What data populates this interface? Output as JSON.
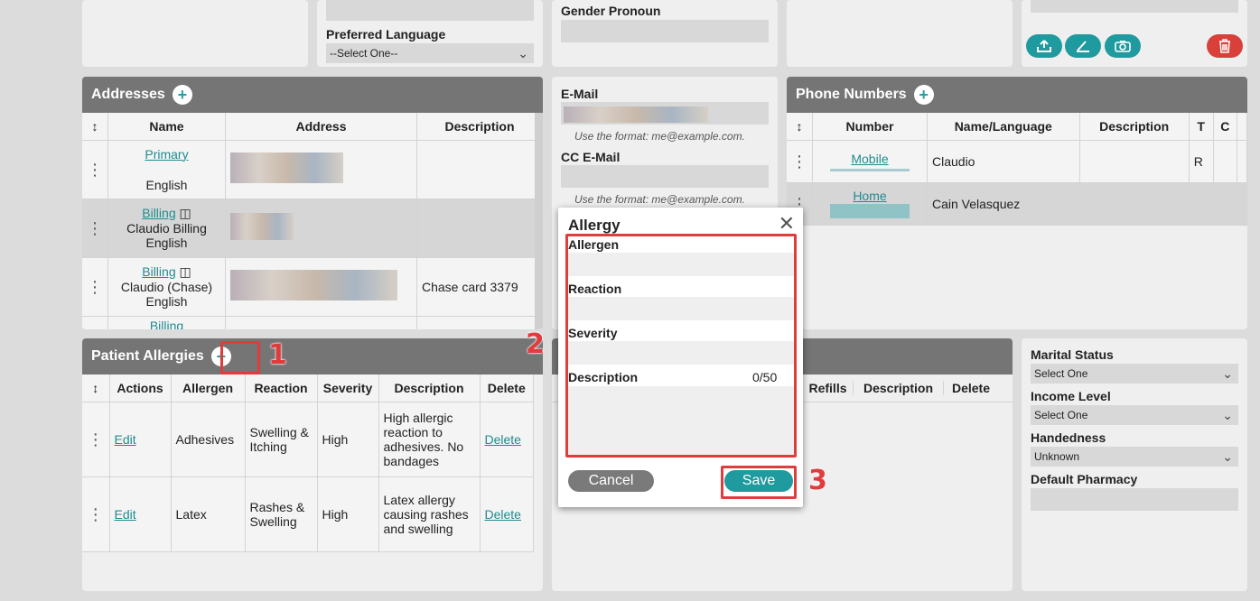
{
  "demographics": {
    "preferred_language_label": "Preferred Language",
    "preferred_language_value": "--Select One--",
    "gender_pronoun_label": "Gender Pronoun"
  },
  "addresses": {
    "title": "Addresses",
    "columns": [
      "Name",
      "Address",
      "Description"
    ],
    "rows": [
      {
        "name_link": "Primary",
        "name_sub": "",
        "lang": "English",
        "description": ""
      },
      {
        "name_link": "Billing",
        "name_sub": "Claudio Billing",
        "lang": "English",
        "description": ""
      },
      {
        "name_link": "Billing",
        "name_sub": "Claudio (Chase)",
        "lang": "English",
        "description": "Chase card 3379"
      },
      {
        "name_link": "Billing",
        "name_sub": "",
        "lang": "",
        "description": ""
      }
    ]
  },
  "contact": {
    "email_label": "E-Mail",
    "email_hint": "Use the format: me@example.com.",
    "cc_email_label": "CC E-Mail",
    "cc_email_hint": "Use the format: me@example.com."
  },
  "phones": {
    "title": "Phone Numbers",
    "columns": [
      "Number",
      "Name/Language",
      "Description",
      "T",
      "C"
    ],
    "rows": [
      {
        "number_link": "Mobile",
        "name": "Claudio",
        "description": "",
        "t": "R",
        "c": ""
      },
      {
        "number_link": "Home",
        "name": "Cain Velasquez",
        "description": "",
        "t": "",
        "c": ""
      }
    ]
  },
  "allergies": {
    "title": "Patient Allergies",
    "columns": [
      "Actions",
      "Allergen",
      "Reaction",
      "Severity",
      "Description",
      "Delete"
    ],
    "rows": [
      {
        "action": "Edit",
        "allergen": "Adhesives",
        "reaction": "Swelling & Itching",
        "severity": "High",
        "description": "High allergic reaction to adhesives. No bandages",
        "delete": "Delete"
      },
      {
        "action": "Edit",
        "allergen": "Latex",
        "reaction": "Rashes & Swelling",
        "severity": "High",
        "description": "Latex allergy causing rashes and swelling",
        "delete": "Delete"
      }
    ]
  },
  "medications": {
    "columns": [
      "Refills",
      "Description",
      "Delete"
    ]
  },
  "profile": {
    "marital_status_label": "Marital Status",
    "marital_status_value": "Select One",
    "income_level_label": "Income Level",
    "income_level_value": "Select One",
    "handedness_label": "Handedness",
    "handedness_value": "Unknown",
    "default_pharmacy_label": "Default Pharmacy"
  },
  "modal": {
    "title": "Allergy",
    "allergen_label": "Allergen",
    "reaction_label": "Reaction",
    "severity_label": "Severity",
    "description_label": "Description",
    "description_counter": "0/50",
    "cancel_label": "Cancel",
    "save_label": "Save"
  },
  "annotations": [
    "1",
    "2",
    "3"
  ],
  "colors": {
    "accent": "#1f9a9e",
    "header": "#757575",
    "danger": "#d9403a",
    "annotation": "#e03c3c"
  }
}
